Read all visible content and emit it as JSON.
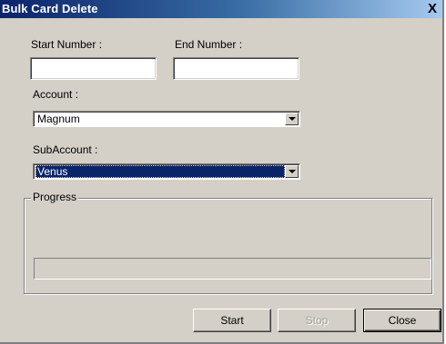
{
  "window": {
    "title": "Bulk Card Delete",
    "close_glyph": "X"
  },
  "form": {
    "start_number": {
      "label": "Start Number :",
      "value": ""
    },
    "end_number": {
      "label": "End Number :",
      "value": ""
    },
    "account": {
      "label": "Account :",
      "value": "Magnum"
    },
    "subaccount": {
      "label": "SubAccount :",
      "value": "Venus"
    }
  },
  "progress": {
    "label": "Progress",
    "value": 0
  },
  "buttons": {
    "start": {
      "label": "Start",
      "enabled": true
    },
    "stop": {
      "label": "Stop",
      "enabled": false
    },
    "close": {
      "label": "Close",
      "enabled": true
    }
  },
  "colors": {
    "face": "#d4d0c8",
    "title_bar": "#0a246a",
    "selection": "#0a246a"
  },
  "icons": {
    "close": "close-icon",
    "dropdown": "chevron-down-icon"
  }
}
